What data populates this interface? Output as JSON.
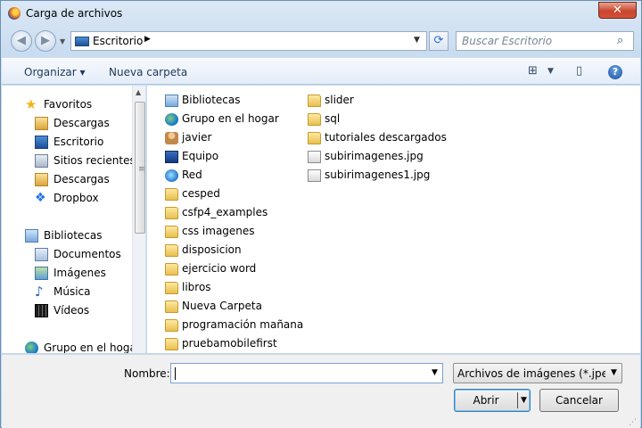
{
  "window": {
    "title": "Carga de archivos",
    "close_symbol": "✕"
  },
  "nav": {
    "back_symbol": "◀",
    "forward_symbol": "▶",
    "address_text": "Escritorio",
    "search_placeholder": "Buscar Escritorio"
  },
  "toolbar": {
    "organize_label": "Organizar ▾",
    "new_folder_label": "Nueva carpeta",
    "help_symbol": "?"
  },
  "sidebar": {
    "items": [
      {
        "label": "Favoritos",
        "icon": "star-icon"
      },
      {
        "label": "Descargas",
        "icon": "downloads-folder-icon"
      },
      {
        "label": "Escritorio",
        "icon": "desktop-icon"
      },
      {
        "label": "Sitios recientes",
        "icon": "recent-places-icon"
      },
      {
        "label": "Descargas",
        "icon": "downloads-folder-icon"
      },
      {
        "label": "Dropbox",
        "icon": "dropbox-icon"
      },
      {
        "label": "Bibliotecas",
        "icon": "libraries-icon"
      },
      {
        "label": "Documentos",
        "icon": "documents-icon"
      },
      {
        "label": "Imágenes",
        "icon": "pictures-icon"
      },
      {
        "label": "Música",
        "icon": "music-icon"
      },
      {
        "label": "Vídeos",
        "icon": "videos-icon"
      },
      {
        "label": "Grupo en el hogar",
        "icon": "homegroup-icon"
      }
    ]
  },
  "files": {
    "col1": [
      {
        "label": "Bibliotecas",
        "icon": "libraries-icon"
      },
      {
        "label": "Grupo en el hogar",
        "icon": "homegroup-icon"
      },
      {
        "label": "javier",
        "icon": "user-folder-icon"
      },
      {
        "label": "Equipo",
        "icon": "computer-icon"
      },
      {
        "label": "Red",
        "icon": "network-icon"
      },
      {
        "label": "cesped",
        "icon": "folder-icon"
      },
      {
        "label": "csfp4_examples",
        "icon": "folder-icon"
      },
      {
        "label": "css imagenes",
        "icon": "folder-icon"
      },
      {
        "label": "disposicion",
        "icon": "folder-icon"
      },
      {
        "label": "ejercicio word",
        "icon": "folder-icon"
      },
      {
        "label": "libros",
        "icon": "folder-icon"
      },
      {
        "label": "Nueva Carpeta",
        "icon": "folder-icon"
      },
      {
        "label": "programación mañana",
        "icon": "folder-icon"
      },
      {
        "label": "pruebamobilefirst",
        "icon": "folder-icon"
      }
    ],
    "col2": [
      {
        "label": "slider",
        "icon": "folder-icon"
      },
      {
        "label": "sql",
        "icon": "folder-icon"
      },
      {
        "label": "tutoriales descargados",
        "icon": "folder-icon"
      },
      {
        "label": "subirimagenes.jpg",
        "icon": "image-file-icon"
      },
      {
        "label": "subirimagenes1.jpg",
        "icon": "image-file-icon"
      }
    ]
  },
  "footer": {
    "name_label": "Nombre:",
    "name_value": "",
    "filter_value": "Archivos de imágenes (*.jpe;*.jpg",
    "open_label": "Abrir",
    "cancel_label": "Cancelar"
  }
}
